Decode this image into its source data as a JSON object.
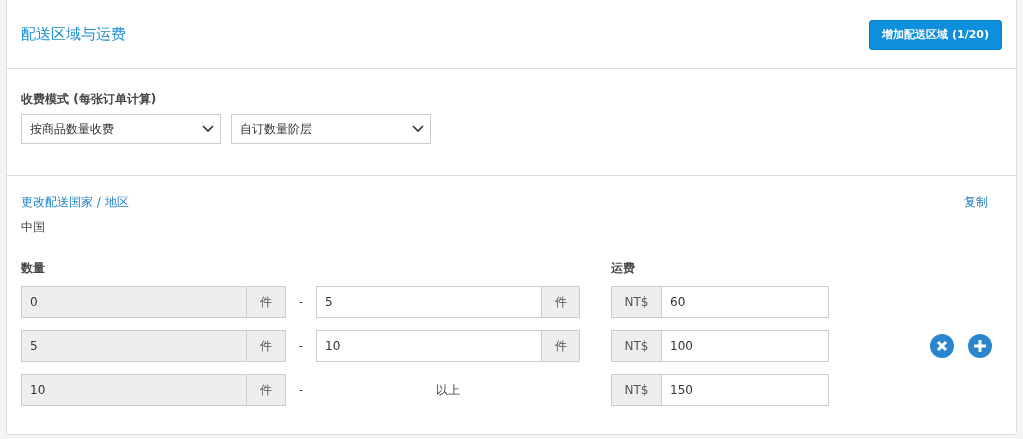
{
  "header": {
    "title": "配送区域与运费",
    "add_button": "增加配送区域 (1/20)"
  },
  "fee_mode": {
    "label": "收费模式 (每张订单计算)",
    "selects": [
      "按商品数量收费",
      "自订数量阶层"
    ]
  },
  "region": {
    "change_link": "更改配送国家 / 地区",
    "copy_link": "复制",
    "country": "中国"
  },
  "table": {
    "quantity_label": "数量",
    "fee_label": "运费",
    "rows": [
      {
        "kind": "range",
        "min": "0",
        "min_unit": "件",
        "dash": "-",
        "max": "5",
        "max_unit": "件",
        "currency": "NT$",
        "fee": "60",
        "removable": false,
        "addable": false
      },
      {
        "kind": "range",
        "min": "5",
        "min_unit": "件",
        "dash": "-",
        "max": "10",
        "max_unit": "件",
        "currency": "NT$",
        "fee": "100",
        "removable": true,
        "addable": true
      },
      {
        "kind": "open",
        "min": "10",
        "min_unit": "件",
        "dash": "-",
        "max": "以上",
        "currency": "NT$",
        "fee": "150",
        "removable": false,
        "addable": false
      }
    ]
  }
}
